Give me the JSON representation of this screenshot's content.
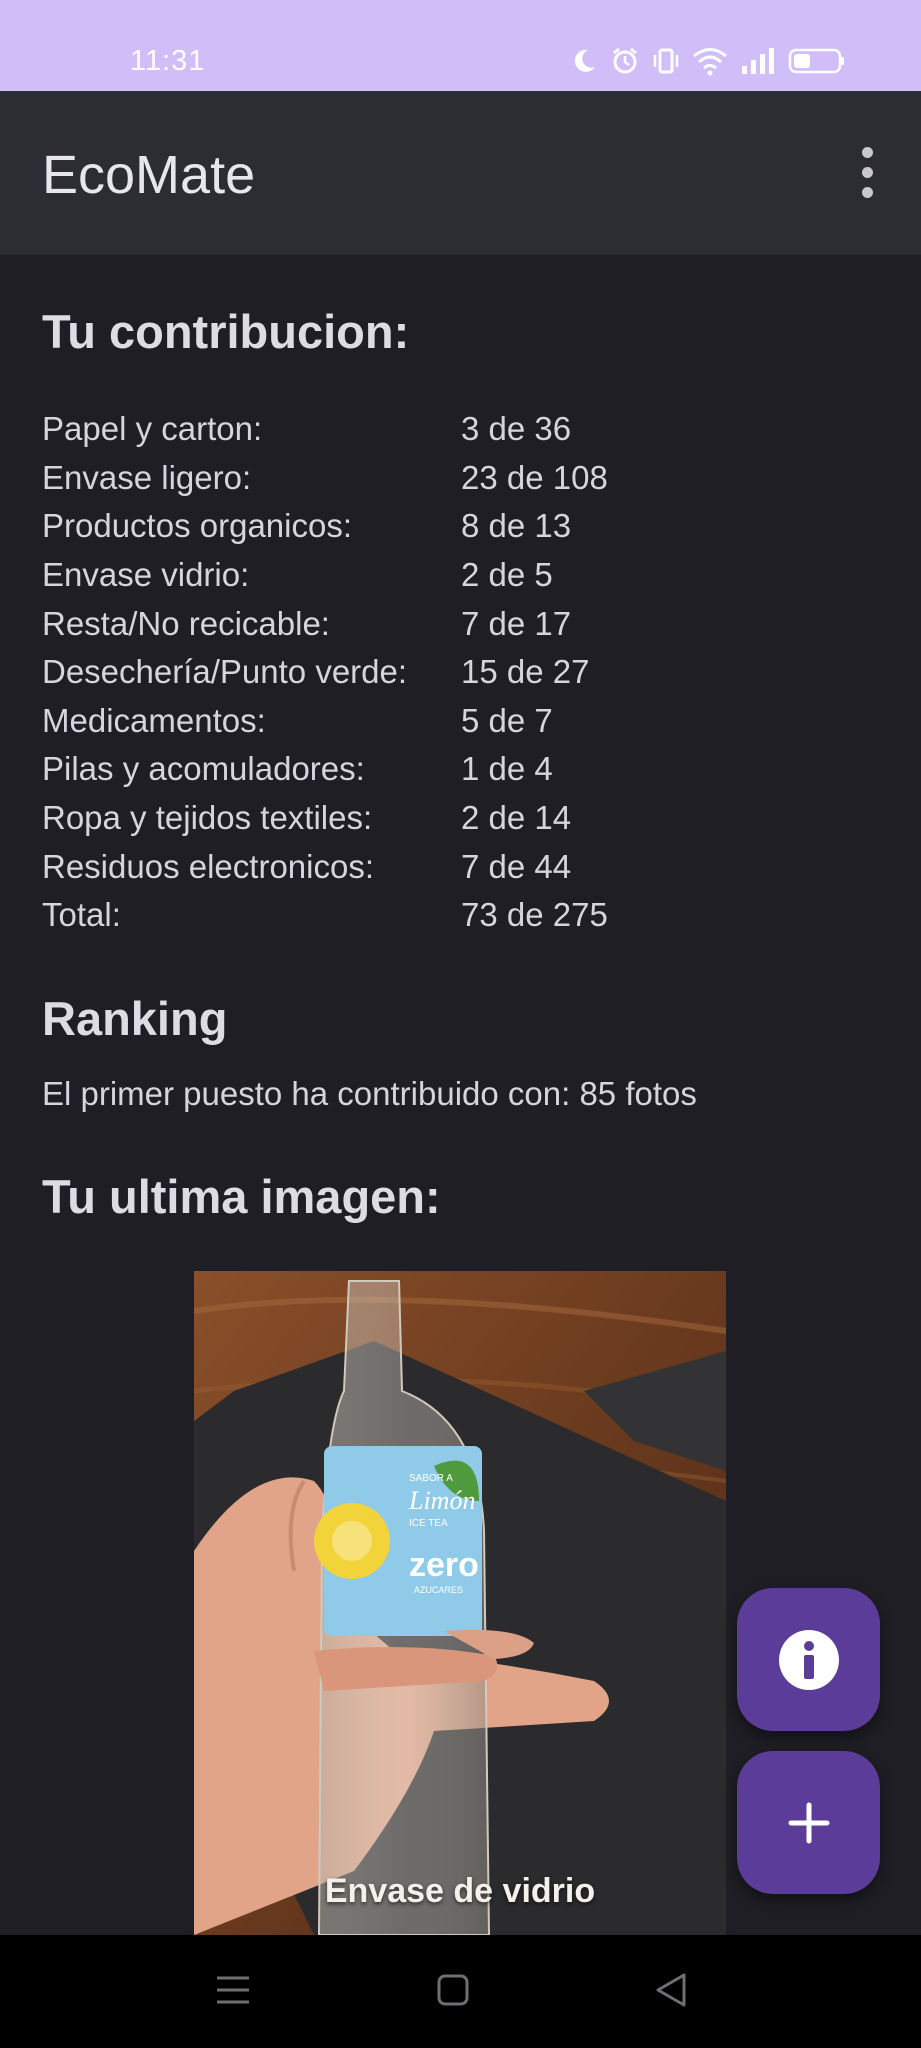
{
  "status_bar": {
    "time": "11:31",
    "icons": [
      "moon-icon",
      "alarm-icon",
      "vibrate-icon",
      "wifi-icon",
      "signal-icon",
      "battery-icon"
    ]
  },
  "app_bar": {
    "title": "EcoMate",
    "menu_icon": "more-vert-icon"
  },
  "contribution": {
    "heading": "Tu contribucion:",
    "rows": [
      {
        "label": "Papel y carton:",
        "value": "3 de 36"
      },
      {
        "label": "Envase ligero:",
        "value": "23 de 108"
      },
      {
        "label": "Productos organicos:",
        "value": "8 de 13"
      },
      {
        "label": "Envase vidrio:",
        "value": "2 de 5"
      },
      {
        "label": "Resta/No recicable:",
        "value": "7 de 17"
      },
      {
        "label": "Desechería/Punto verde:",
        "value": "15 de 27"
      },
      {
        "label": "Medicamentos:",
        "value": "5 de 7"
      },
      {
        "label": "Pilas y acomuladores:",
        "value": "1 de 4"
      },
      {
        "label": "Ropa y tejidos textiles:",
        "value": "2 de 14"
      },
      {
        "label": "Residuos electronicos:",
        "value": "7 de 44"
      },
      {
        "label": "Total:",
        "value": "73 de 275"
      }
    ]
  },
  "ranking": {
    "heading": "Ranking",
    "text": "El primer puesto ha contribuido con: 85 fotos"
  },
  "last_image": {
    "heading": "Tu ultima imagen:",
    "caption": "Envase de vidrio",
    "label_lines": [
      "SABOR A",
      "Limón",
      "ICE TEA",
      "zero",
      "AZUCARES"
    ]
  },
  "fabs": {
    "info_icon": "info-icon",
    "add_icon": "plus-icon"
  },
  "colors": {
    "status_bar": "#d1bdf7",
    "app_bar": "#2c2c33",
    "background": "#1f1e24",
    "fab": "#5c3c99"
  }
}
